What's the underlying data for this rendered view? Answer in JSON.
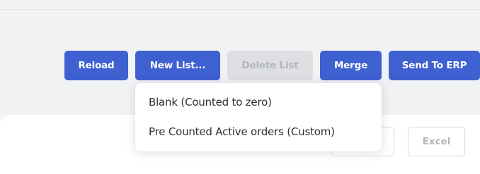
{
  "toolbar": {
    "reload_label": "Reload",
    "new_list_label": "New List...",
    "delete_list_label": "Delete List",
    "merge_label": "Merge",
    "send_to_erp_label": "Send To ERP"
  },
  "new_list_menu": {
    "items": [
      {
        "label": "Blank (Counted to zero)"
      },
      {
        "label": "Pre Counted Active orders (Custom)"
      }
    ]
  },
  "secondary_actions": {
    "excel_label": "Excel"
  },
  "colors": {
    "primary": "#3f60d1",
    "disabled": "#dedfe3",
    "disabled_text": "#b2b5bd"
  }
}
